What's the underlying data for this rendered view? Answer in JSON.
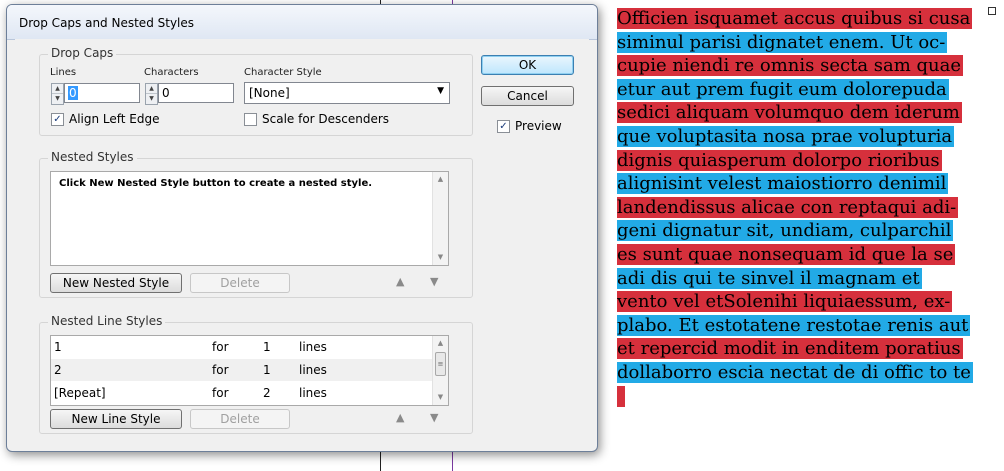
{
  "dialog": {
    "title": "Drop Caps and Nested Styles",
    "ok_label": "OK",
    "cancel_label": "Cancel",
    "preview_label": "Preview",
    "preview_checked": true
  },
  "drop_caps": {
    "group_label": "Drop Caps",
    "lines_label": "Lines",
    "lines_value": "0",
    "characters_label": "Characters",
    "characters_value": "0",
    "character_style_label": "Character Style",
    "character_style_value": "[None]",
    "align_left_edge_label": "Align Left Edge",
    "align_left_edge_checked": true,
    "scale_descenders_label": "Scale for Descenders",
    "scale_descenders_checked": false
  },
  "nested_styles": {
    "group_label": "Nested Styles",
    "hint": "Click New Nested Style button to create a nested style.",
    "new_button": "New Nested Style",
    "delete_button": "Delete"
  },
  "nested_line_styles": {
    "group_label": "Nested Line Styles",
    "rows": [
      {
        "style": "1",
        "for": "for",
        "count": "1",
        "unit": "lines"
      },
      {
        "style": "2",
        "for": "for",
        "count": "1",
        "unit": "lines"
      },
      {
        "style": "[Repeat]",
        "for": "for",
        "count": "2",
        "unit": "lines"
      }
    ],
    "new_button": "New Line Style",
    "delete_button": "Delete"
  },
  "text_frame": {
    "lines": [
      {
        "text": "Officien isquamet accus quibus si cusa",
        "color": "red"
      },
      {
        "text": "siminul parisi dignatet enem. Ut oc-",
        "color": "blue"
      },
      {
        "text": "cupie niendi re omnis secta sam quae",
        "color": "red"
      },
      {
        "text": "etur aut prem fugit eum dolorepuda",
        "color": "blue"
      },
      {
        "text": "sedici aliquam volumquo dem iderum",
        "color": "red"
      },
      {
        "text": "que voluptasita nosa prae volupturia",
        "color": "blue"
      },
      {
        "text": "dignis quiasperum dolorpo rioribus",
        "color": "red"
      },
      {
        "text": "alignisint velest maiostiorro denimil",
        "color": "blue"
      },
      {
        "text": "landendissus alicae con reptaqui adi-",
        "color": "red"
      },
      {
        "text": "geni dignatur sit, undiam, culparchil",
        "color": "blue"
      },
      {
        "text": "es sunt quae nonsequam id que la se",
        "color": "red"
      },
      {
        "text": "adi dis qui te sinvel il magnam et",
        "color": "blue"
      },
      {
        "text": "vento vel etSolenihi liquiaessum, ex-",
        "color": "red"
      },
      {
        "text": "plabo. Et estotatene restotae renis aut",
        "color": "blue"
      },
      {
        "text": "et repercid modit in enditem poratius",
        "color": "red"
      },
      {
        "text": "dollaborro escia nectat de di offic to te",
        "color": "blue"
      },
      {
        "text": "",
        "color": "red"
      }
    ],
    "colors": {
      "red": "#d6303c",
      "blue": "#22aae6"
    }
  }
}
